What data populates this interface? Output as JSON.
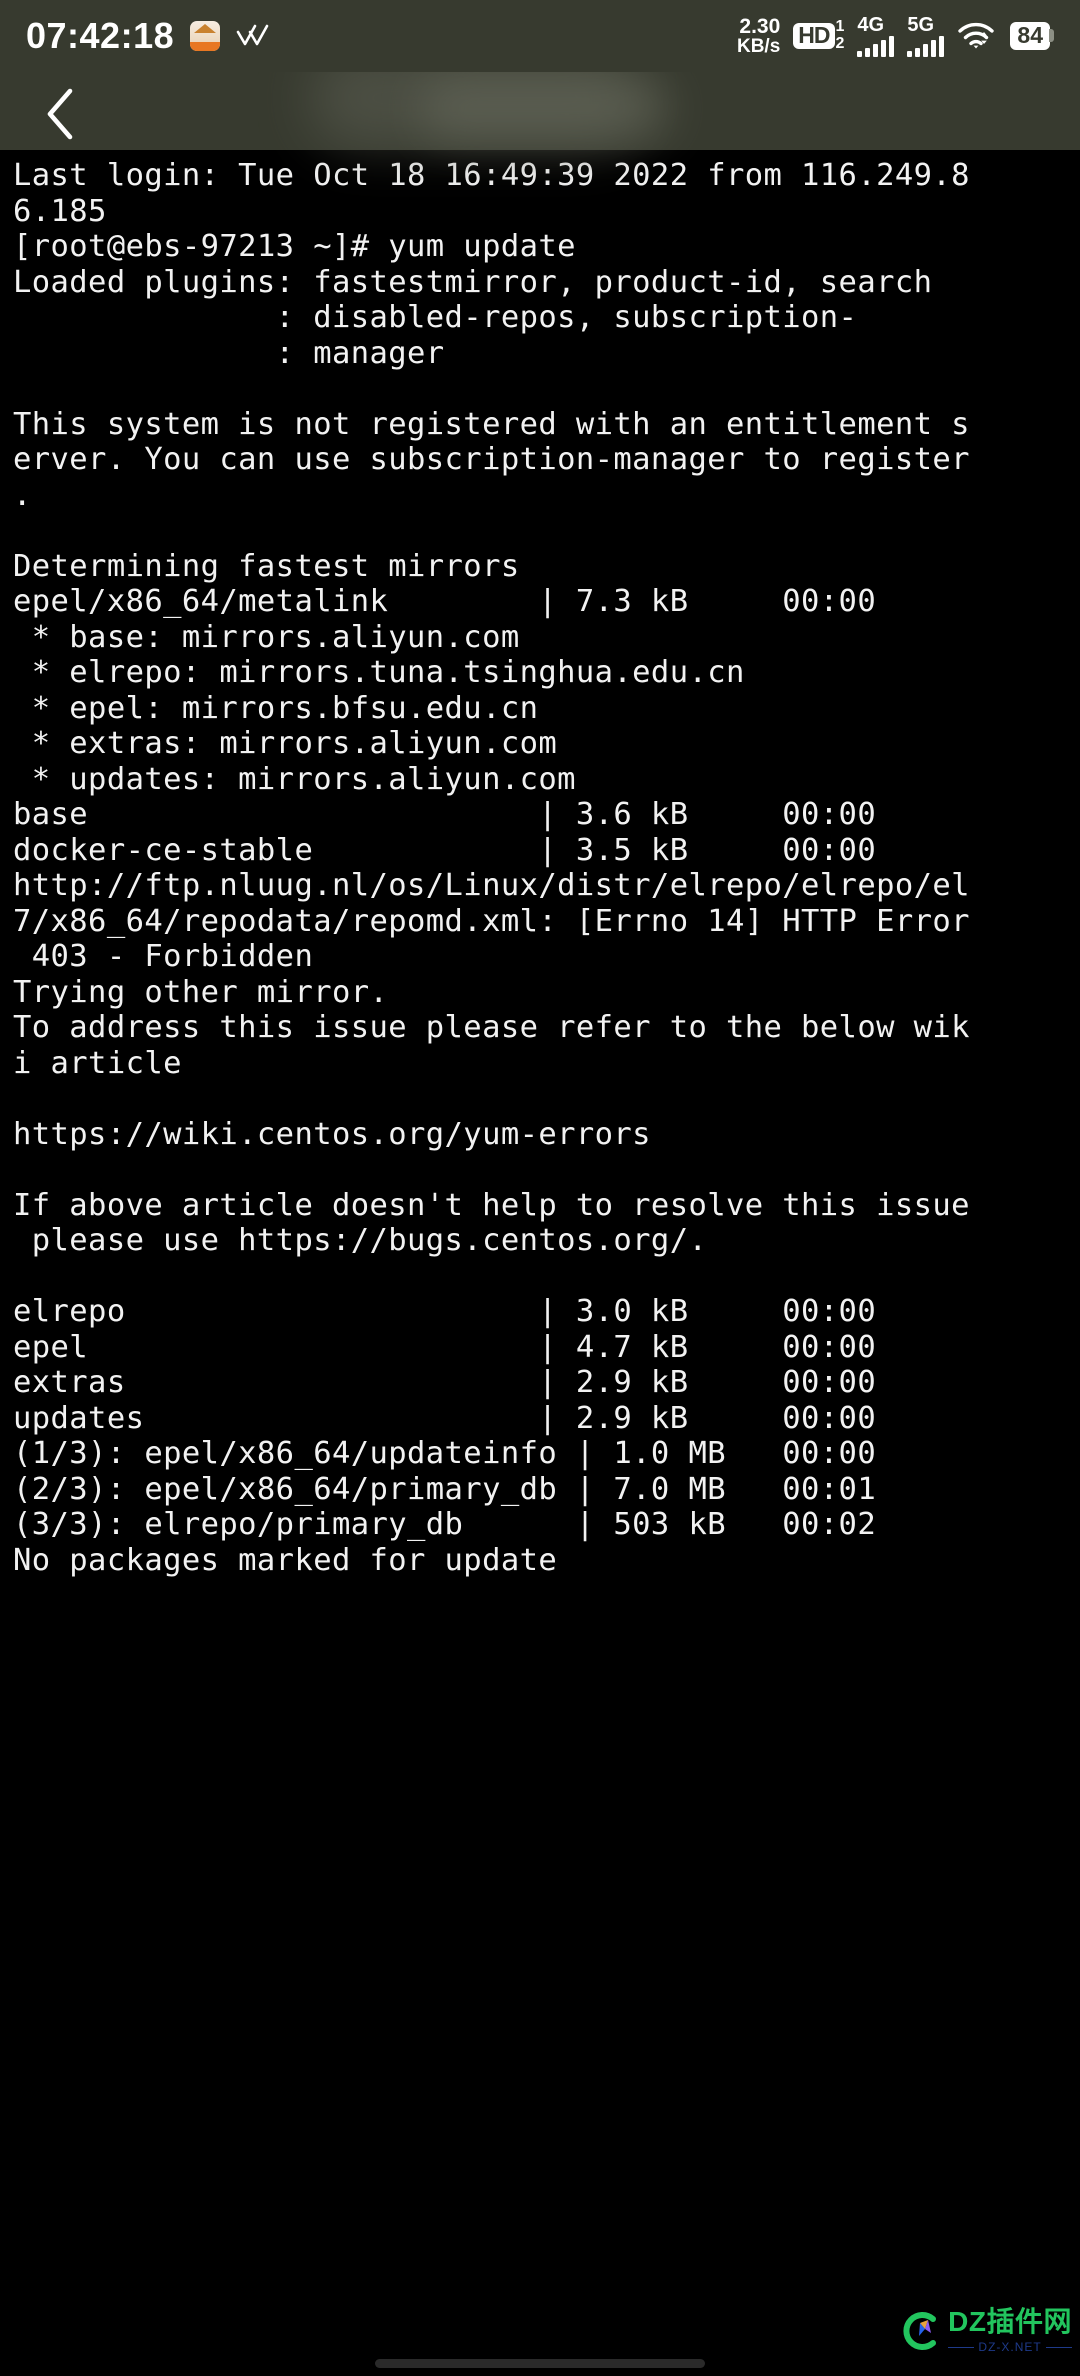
{
  "statusbar": {
    "clock": "07:42:18",
    "app_badge_icon": "app-notification-icon",
    "double_check_icon": "double-check-icon",
    "netspeed_value": "2.30",
    "netspeed_unit": "KB/s",
    "hd_label": "HD",
    "hd_sim_1": "1",
    "hd_sim_2": "2",
    "sim1_network": "4G",
    "sim2_network": "5G",
    "wifi_icon": "wifi-icon",
    "battery_level": "84"
  },
  "navbar": {
    "back_icon": "back-chevron-icon",
    "title": ""
  },
  "terminal": {
    "lines": [
      "Last login: Tue Oct 18 16:49:39 2022 from 116.249.8",
      "6.185",
      "[root@ebs-97213 ~]# yum update",
      "Loaded plugins: fastestmirror, product-id, search",
      "              : disabled-repos, subscription-",
      "              : manager",
      "",
      "This system is not registered with an entitlement s",
      "erver. You can use subscription-manager to register",
      ".",
      "",
      "Determining fastest mirrors",
      "epel/x86_64/metalink        | 7.3 kB     00:00",
      " * base: mirrors.aliyun.com",
      " * elrepo: mirrors.tuna.tsinghua.edu.cn",
      " * epel: mirrors.bfsu.edu.cn",
      " * extras: mirrors.aliyun.com",
      " * updates: mirrors.aliyun.com",
      "base                        | 3.6 kB     00:00",
      "docker-ce-stable            | 3.5 kB     00:00",
      "http://ftp.nluug.nl/os/Linux/distr/elrepo/elrepo/el",
      "7/x86_64/repodata/repomd.xml: [Errno 14] HTTP Error",
      " 403 - Forbidden",
      "Trying other mirror.",
      "To address this issue please refer to the below wik",
      "i article",
      "",
      "https://wiki.centos.org/yum-errors",
      "",
      "If above article doesn't help to resolve this issue",
      " please use https://bugs.centos.org/.",
      "",
      "elrepo                      | 3.0 kB     00:00",
      "epel                        | 4.7 kB     00:00",
      "extras                      | 2.9 kB     00:00",
      "updates                     | 2.9 kB     00:00",
      "(1/3): epel/x86_64/updateinfo | 1.0 MB   00:00",
      "(2/3): epel/x86_64/primary_db | 7.0 MB   00:01",
      "(3/3): elrepo/primary_db      | 503 kB   00:02",
      "No packages marked for update"
    ]
  },
  "watermark": {
    "logo_icon": "dz-logo-icon",
    "title": "DZ插件网",
    "subtitle": "DZ-X.NET"
  },
  "colors": {
    "statusbar_bg": "#373a2f",
    "terminal_bg": "#000000",
    "terminal_fg": "#f2f2f2",
    "accent_orange": "#e87722",
    "watermark_green": "#22c55e",
    "watermark_blue": "#1e3a8a"
  }
}
